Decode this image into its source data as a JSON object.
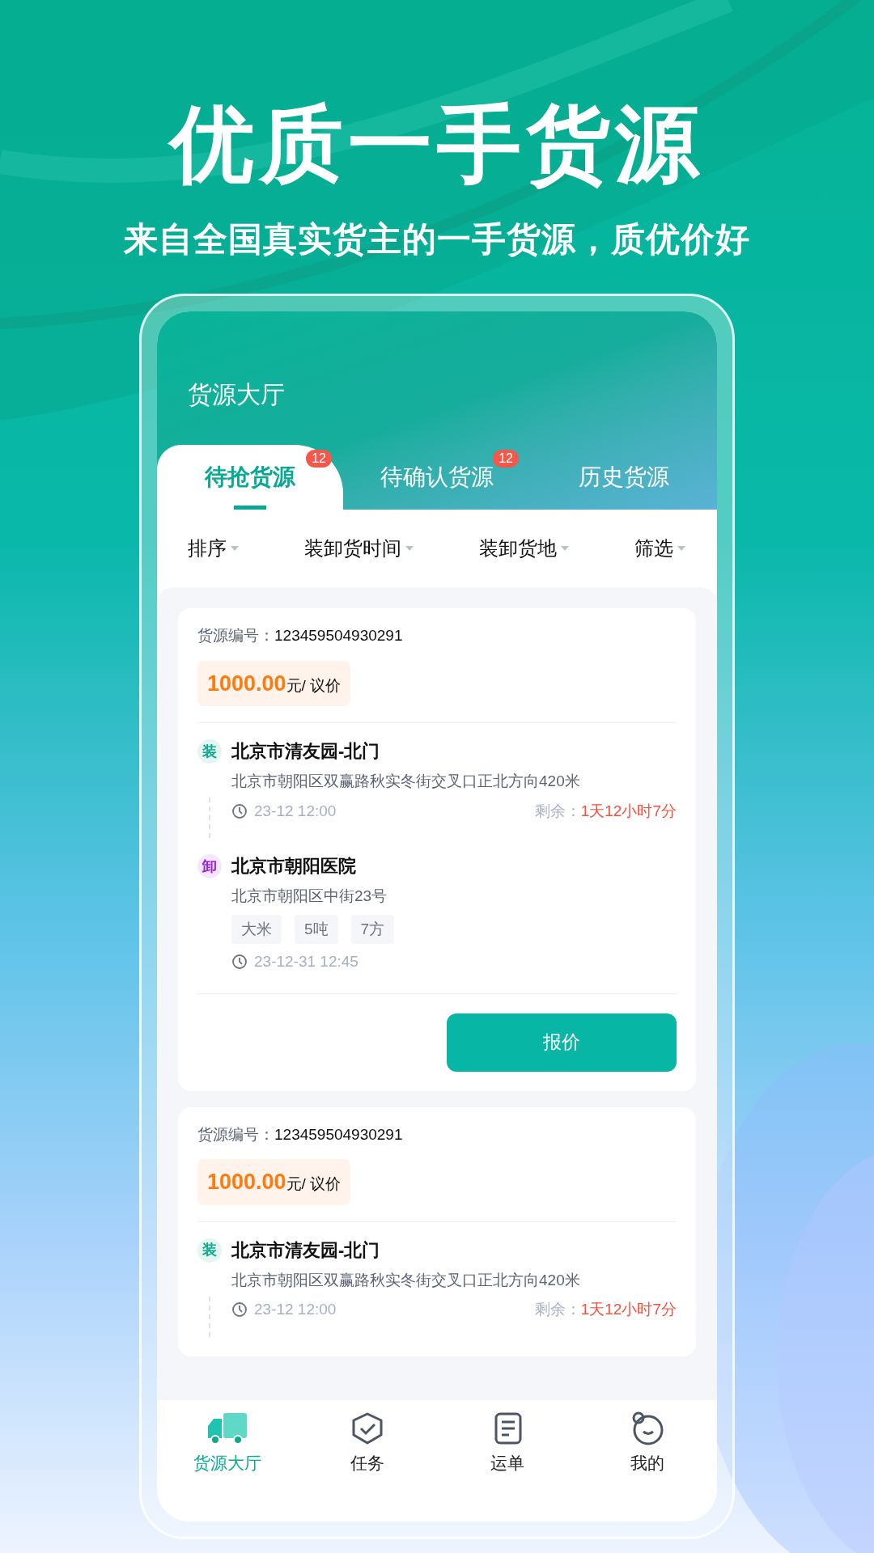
{
  "headline": "优质一手货源",
  "subheadline": "来自全国真实货主的一手货源，质优价好",
  "app": {
    "title": "货源大厅",
    "tabs": [
      {
        "label": "待抢货源",
        "badge": "12",
        "selected": true
      },
      {
        "label": "待确认货源",
        "badge": "12",
        "selected": false
      },
      {
        "label": "历史货源",
        "selected": false
      }
    ],
    "filters": [
      "排序",
      "装卸货时间",
      "装卸货地"
    ],
    "filter_last": "筛选",
    "cards": [
      {
        "id_label": "货源编号：",
        "id": "123459504930291",
        "price": "1000.00",
        "price_unit": "元/ 议价",
        "stops": [
          {
            "kind": "load",
            "mark": "装",
            "name": "北京市清友园-北门",
            "address": "北京市朝阳区双赢路秋实冬街交叉口正北方向420米",
            "time": "23-12 12:00",
            "remain_label": "剩余：",
            "remain": "1天12小时7分"
          },
          {
            "kind": "unload",
            "mark": "卸",
            "name": "北京市朝阳医院",
            "address": "北京市朝阳区中街23号",
            "tags": [
              "大米",
              "5吨",
              "7方"
            ],
            "time": "23-12-31 12:45"
          }
        ],
        "button": "报价"
      },
      {
        "id_label": "货源编号：",
        "id": "123459504930291",
        "price": "1000.00",
        "price_unit": "元/ 议价",
        "stops": [
          {
            "kind": "load",
            "mark": "装",
            "name": "北京市清友园-北门",
            "address": "北京市朝阳区双赢路秋实冬街交叉口正北方向420米",
            "time": "23-12 12:00",
            "remain_label": "剩余：",
            "remain": "1天12小时7分"
          }
        ]
      }
    ],
    "nav": [
      {
        "kind": "truck",
        "label": "货源大厅",
        "selected": true
      },
      {
        "kind": "task",
        "label": "任务",
        "selected": false
      },
      {
        "kind": "list",
        "label": "运单",
        "selected": false
      },
      {
        "kind": "face",
        "label": "我的",
        "selected": false
      }
    ]
  }
}
